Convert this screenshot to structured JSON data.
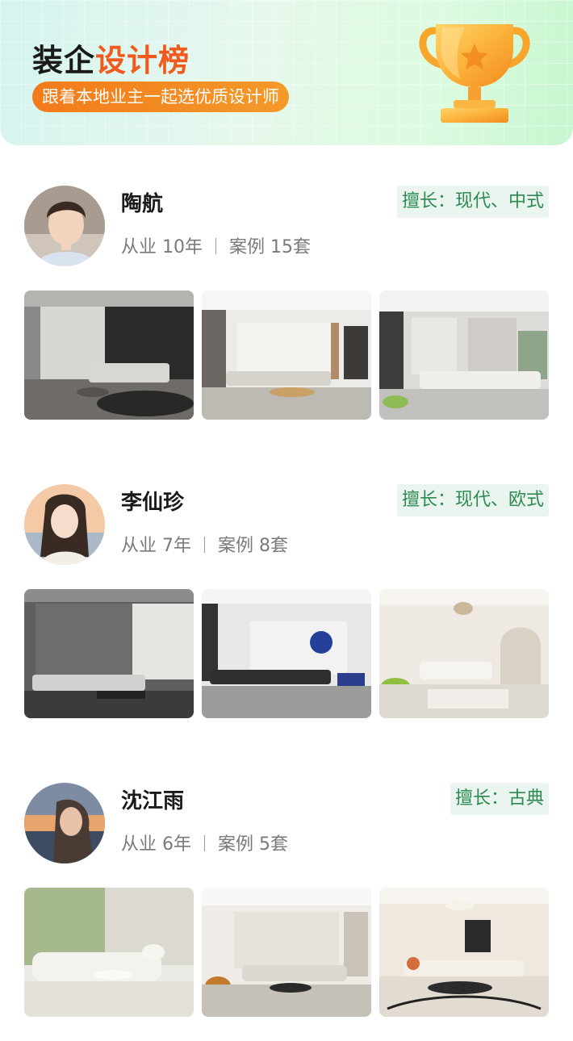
{
  "banner": {
    "title_dark": "装企",
    "title_accent": "设计榜",
    "subtitle": "跟着本地业主一起选优质设计师",
    "trophy_icon": "trophy-icon",
    "colors": {
      "accent": "#f05a1e",
      "pill": "#f27a1a"
    }
  },
  "designers": [
    {
      "name": "陶航",
      "years": "从业 10年",
      "cases": "案例 15套",
      "specialty": "擅长：现代、中式",
      "photos": [
        "living-room-dark-modern",
        "living-room-white-modern",
        "living-room-gray-minimal"
      ]
    },
    {
      "name": "李仙珍",
      "years": "从业 7年",
      "cases": "案例 8套",
      "specialty": "擅长：现代、欧式",
      "photos": [
        "living-room-gray-wall",
        "living-room-blue-art",
        "living-room-arch-cream"
      ]
    },
    {
      "name": "沈江雨",
      "years": "从业 6年",
      "cases": "案例 5套",
      "specialty": "擅长：古典",
      "photos": [
        "living-room-green-wall",
        "living-room-beige-sofa",
        "living-room-art-rug"
      ]
    }
  ]
}
